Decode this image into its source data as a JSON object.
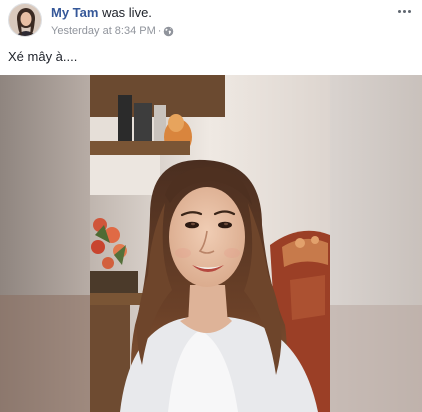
{
  "post": {
    "author": "My Tam",
    "action_text": "was live.",
    "timestamp": "Yesterday at 8:34 PM",
    "separator": "·",
    "privacy_icon": "globe-icon",
    "more_icon": "more-options-icon",
    "text": "Xé mây à...."
  },
  "colors": {
    "author_link": "#365899",
    "meta_text": "#90949c",
    "body_text": "#1d2129"
  }
}
